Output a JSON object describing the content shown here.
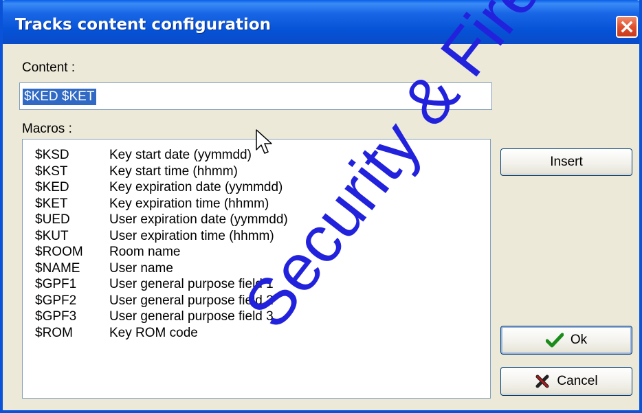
{
  "window": {
    "title": "Tracks content configuration"
  },
  "content": {
    "label": "Content :",
    "value": "$KED $KET"
  },
  "macros": {
    "label": "Macros :",
    "items": [
      {
        "code": "$KSD",
        "desc": "Key start date  (yymmdd)"
      },
      {
        "code": "$KST",
        "desc": "Key start time  (hhmm)"
      },
      {
        "code": "$KED",
        "desc": "Key expiration date  (yymmdd)"
      },
      {
        "code": "$KET",
        "desc": "Key expiration time  (hhmm)"
      },
      {
        "code": "$UED",
        "desc": "User expiration date  (yymmdd)"
      },
      {
        "code": "$KUT",
        "desc": "User expiration time  (hhmm)"
      },
      {
        "code": "$ROOM",
        "desc": "Room name"
      },
      {
        "code": "$NAME",
        "desc": "User name"
      },
      {
        "code": "$GPF1",
        "desc": "User general purpose field  1"
      },
      {
        "code": "$GPF2",
        "desc": "User general purpose field  2"
      },
      {
        "code": "$GPF3",
        "desc": "User general purpose field  3"
      },
      {
        "code": "$ROM",
        "desc": "Key ROM code"
      }
    ]
  },
  "buttons": {
    "insert": "Insert",
    "ok": "Ok",
    "cancel": "Cancel"
  },
  "watermark": "Security & Fire",
  "icons": {
    "close": "close-icon",
    "ok": "checkmark-icon",
    "cancel": "x-icon"
  },
  "colors": {
    "titlebar": "#0552d6",
    "selection": "#316ac5",
    "watermark": "#2222dd",
    "ok_check": "#1a8c1a",
    "cancel_x": "#222222"
  }
}
